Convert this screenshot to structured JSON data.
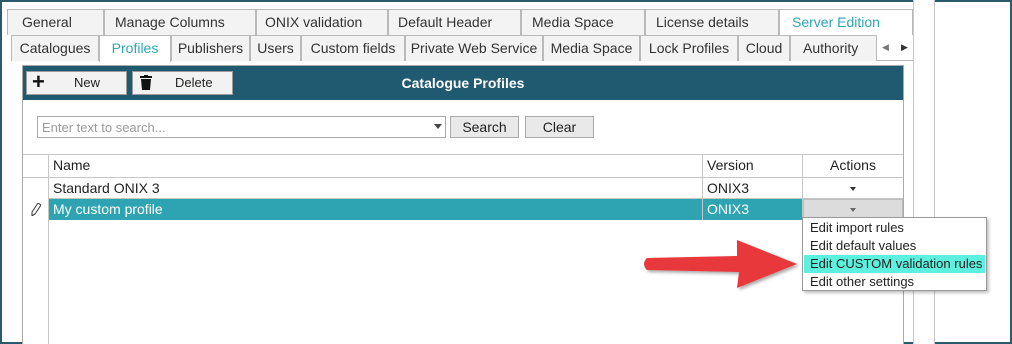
{
  "top_tabs": [
    {
      "label": "General",
      "active": false
    },
    {
      "label": "Manage Columns",
      "active": false
    },
    {
      "label": "ONIX validation",
      "active": false
    },
    {
      "label": "Default Header",
      "active": false
    },
    {
      "label": "Media Space",
      "active": false
    },
    {
      "label": "License details",
      "active": false
    },
    {
      "label": "Server Edition",
      "active": true
    }
  ],
  "sub_tabs": [
    {
      "label": "Catalogues",
      "active": false
    },
    {
      "label": "Profiles",
      "active": true
    },
    {
      "label": "Publishers",
      "active": false
    },
    {
      "label": "Users",
      "active": false
    },
    {
      "label": "Custom fields",
      "active": false
    },
    {
      "label": "Private Web Service",
      "active": false
    },
    {
      "label": "Media Space",
      "active": false
    },
    {
      "label": "Lock Profiles",
      "active": false
    },
    {
      "label": "Cloud",
      "active": false
    },
    {
      "label": "Authority Lis",
      "active": false
    }
  ],
  "scroll_left_glyph": "◀",
  "scroll_right_glyph": "▶",
  "toolbar": {
    "title": "Catalogue Profiles",
    "new_label": "New",
    "new_icon_glyph": "+",
    "delete_label": "Delete"
  },
  "search": {
    "placeholder": "Enter text to search...",
    "value": "",
    "search_button": "Search",
    "clear_button": "Clear"
  },
  "grid": {
    "columns": [
      "Name",
      "Version",
      "Actions"
    ],
    "rows": [
      {
        "name": "Standard ONIX 3",
        "version": "ONIX3",
        "selected": false,
        "editing": false
      },
      {
        "name": "My custom profile",
        "version": "ONIX3",
        "selected": true,
        "editing": true
      }
    ]
  },
  "actions_menu": {
    "items": [
      {
        "label": "Edit import rules",
        "highlighted": false
      },
      {
        "label": "Edit default values",
        "highlighted": false
      },
      {
        "label": "Edit CUSTOM validation rules",
        "highlighted": true
      },
      {
        "label": "Edit other settings",
        "highlighted": false
      }
    ]
  },
  "colors": {
    "header_bar": "#1f5a70",
    "accent": "#2ea4b3",
    "menu_highlight": "#5df0de",
    "annotation_arrow": "#e8383a"
  },
  "icons": {
    "edit_row": "pencil-icon",
    "new": "plus-icon",
    "delete": "trash-icon"
  }
}
